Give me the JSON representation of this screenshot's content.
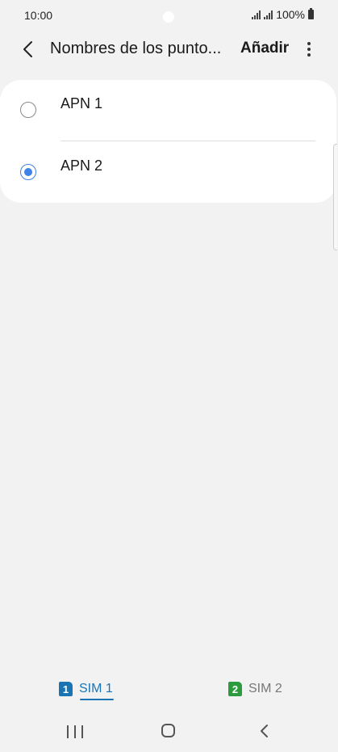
{
  "status_bar": {
    "time": "10:00",
    "battery": "100%"
  },
  "app_bar": {
    "title": "Nombres de los punto...",
    "add_label": "Añadir"
  },
  "apn_list": [
    {
      "label": "APN 1",
      "selected": false
    },
    {
      "label": "APN 2",
      "selected": true
    }
  ],
  "sim_tabs": [
    {
      "badge": "1",
      "label": "SIM 1",
      "active": true,
      "color": "#1a74b4"
    },
    {
      "badge": "2",
      "label": "SIM 2",
      "active": false,
      "color": "#2c9b3e"
    }
  ],
  "colors": {
    "radio_selected": "#3f82e8",
    "active_tab": "#1a74b4",
    "background": "#f2f2f2"
  },
  "icons": {
    "back": "chevron-left-icon",
    "more": "more-vertical-icon",
    "signal": "signal-icon",
    "battery": "battery-icon",
    "nav_recents": "recents-icon",
    "nav_home": "home-icon",
    "nav_back": "back-icon"
  }
}
